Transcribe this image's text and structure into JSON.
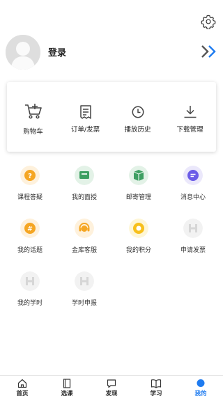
{
  "header": {
    "settings_icon": "gear-icon"
  },
  "profile": {
    "login_label": "登录",
    "avatar_icon": "default-avatar",
    "arrow_icon": "double-chevron-right-icon"
  },
  "quick_actions": [
    {
      "label": "购物车",
      "icon": "cart-icon"
    },
    {
      "label": "订单/发票",
      "icon": "receipt-icon"
    },
    {
      "label": "播放历史",
      "icon": "clock-icon"
    },
    {
      "label": "下载管理",
      "icon": "download-icon"
    }
  ],
  "services": [
    {
      "label": "课程答疑",
      "icon": "question-icon",
      "color": "#f5a623"
    },
    {
      "label": "我的面授",
      "icon": "classroom-icon",
      "color": "#3e9f62"
    },
    {
      "label": "邮寄管理",
      "icon": "package-icon",
      "color": "#3e9f62"
    },
    {
      "label": "消息中心",
      "icon": "message-icon",
      "color": "#6b5ce7"
    },
    {
      "label": "我的话题",
      "icon": "topic-icon",
      "color": "#f5a623"
    },
    {
      "label": "金库客服",
      "icon": "headset-icon",
      "color": "#f5a623"
    },
    {
      "label": "我的积分",
      "icon": "points-icon",
      "color": "#f7c01c"
    },
    {
      "label": "申请发票",
      "icon": "placeholder-icon",
      "color": "#d6d6d6"
    },
    {
      "label": "我的学时",
      "icon": "placeholder-icon",
      "color": "#d6d6d6"
    },
    {
      "label": "学时申报",
      "icon": "placeholder-icon",
      "color": "#d6d6d6"
    }
  ],
  "tabbar": [
    {
      "label": "首页",
      "icon": "home-icon"
    },
    {
      "label": "选课",
      "icon": "book-icon"
    },
    {
      "label": "发现",
      "icon": "chat-icon"
    },
    {
      "label": "学习",
      "icon": "open-book-icon"
    },
    {
      "label": "我的",
      "icon": "profile-dot-icon",
      "active": true
    }
  ],
  "colors": {
    "accent": "#1e7bf0",
    "card_shadow": "#d0d0d0"
  }
}
